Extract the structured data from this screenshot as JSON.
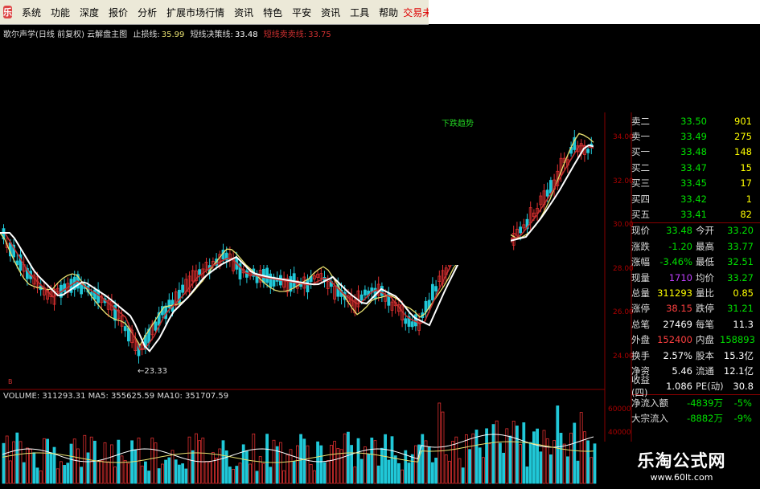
{
  "menu": {
    "items": [
      "系统",
      "功能",
      "深度",
      "报价",
      "分析",
      "扩展市场行情",
      "资讯",
      "特色",
      "平安",
      "资讯",
      "工具",
      "帮助"
    ],
    "logo_char": "乐",
    "login": "交易未登录"
  },
  "chart_header": {
    "name": "歌尔声学(日线 前复权) 云解盘主图",
    "stop_label": "止损线:",
    "stop_value": "35.99",
    "short_label": "短线决策线:",
    "short_value": "33.48",
    "sell_label": "短线卖卖线:",
    "sell_value": "33.75"
  },
  "annotations": {
    "down_trend": "下跌趋势",
    "low_price": "←23.33",
    "marker": "B"
  },
  "price_axis": [
    "34.00",
    "32.00",
    "30.00",
    "28.00",
    "26.00",
    "24.00"
  ],
  "volume_axis": [
    "60000",
    "40000"
  ],
  "volume_header": "VOLUME: 311293.31 MA5: 355625.59 MA10: 351707.59",
  "order_book": [
    {
      "label": "卖二",
      "price": "33.50",
      "vol": "901"
    },
    {
      "label": "卖一",
      "price": "33.49",
      "vol": "275"
    },
    {
      "label": "买一",
      "price": "33.48",
      "vol": "148"
    },
    {
      "label": "买二",
      "price": "33.47",
      "vol": "15"
    },
    {
      "label": "买三",
      "price": "33.45",
      "vol": "17"
    },
    {
      "label": "买四",
      "price": "33.42",
      "vol": "1"
    },
    {
      "label": "买五",
      "price": "33.41",
      "vol": "82"
    }
  ],
  "stats": [
    {
      "l1": "现价",
      "v1": "33.48",
      "c1": "#00e000",
      "l2": "今开",
      "v2": "33.20",
      "c2": "#00e000"
    },
    {
      "l1": "涨跌",
      "v1": "-1.20",
      "c1": "#00e000",
      "l2": "最高",
      "v2": "33.77",
      "c2": "#00e000"
    },
    {
      "l1": "涨幅",
      "v1": "-3.46%",
      "c1": "#00e000",
      "l2": "最低",
      "v2": "32.51",
      "c2": "#00e000"
    },
    {
      "l1": "现量",
      "v1": "1710",
      "c1": "#c040ff",
      "l2": "均价",
      "v2": "33.27",
      "c2": "#00e000"
    },
    {
      "l1": "总量",
      "v1": "311293",
      "c1": "#ffff00",
      "l2": "量比",
      "v2": "0.85",
      "c2": "#ffff00"
    },
    {
      "l1": "涨停",
      "v1": "38.15",
      "c1": "#ff4040",
      "l2": "跌停",
      "v2": "31.21",
      "c2": "#00e000"
    },
    {
      "l1": "总笔",
      "v1": "27469",
      "c1": "#ffffff",
      "l2": "每笔",
      "v2": "11.3",
      "c2": "#ffffff"
    },
    {
      "l1": "外盘",
      "v1": "152400",
      "c1": "#ff4040",
      "l2": "内盘",
      "v2": "158893",
      "c2": "#00e000"
    },
    {
      "l1": "换手",
      "v1": "2.57%",
      "c1": "#ffffff",
      "l2": "股本",
      "v2": "15.3亿",
      "c2": "#ffffff"
    },
    {
      "l1": "净资",
      "v1": "5.46",
      "c1": "#ffffff",
      "l2": "流通",
      "v2": "12.1亿",
      "c2": "#ffffff"
    },
    {
      "l1": "收益(四)",
      "v1": "1.086",
      "c1": "#ffffff",
      "l2": "PE(动)",
      "v2": "30.8",
      "c2": "#ffffff"
    }
  ],
  "flow": [
    {
      "label": "净流入额",
      "value": "-4839万",
      "pct": "-5%",
      "color": "#00e000"
    },
    {
      "label": "大宗流入",
      "value": "-8882万",
      "pct": "-9%",
      "color": "#00e000"
    }
  ],
  "watermark": {
    "title": "乐淘公式网",
    "url": "www.60lt.com"
  }
}
